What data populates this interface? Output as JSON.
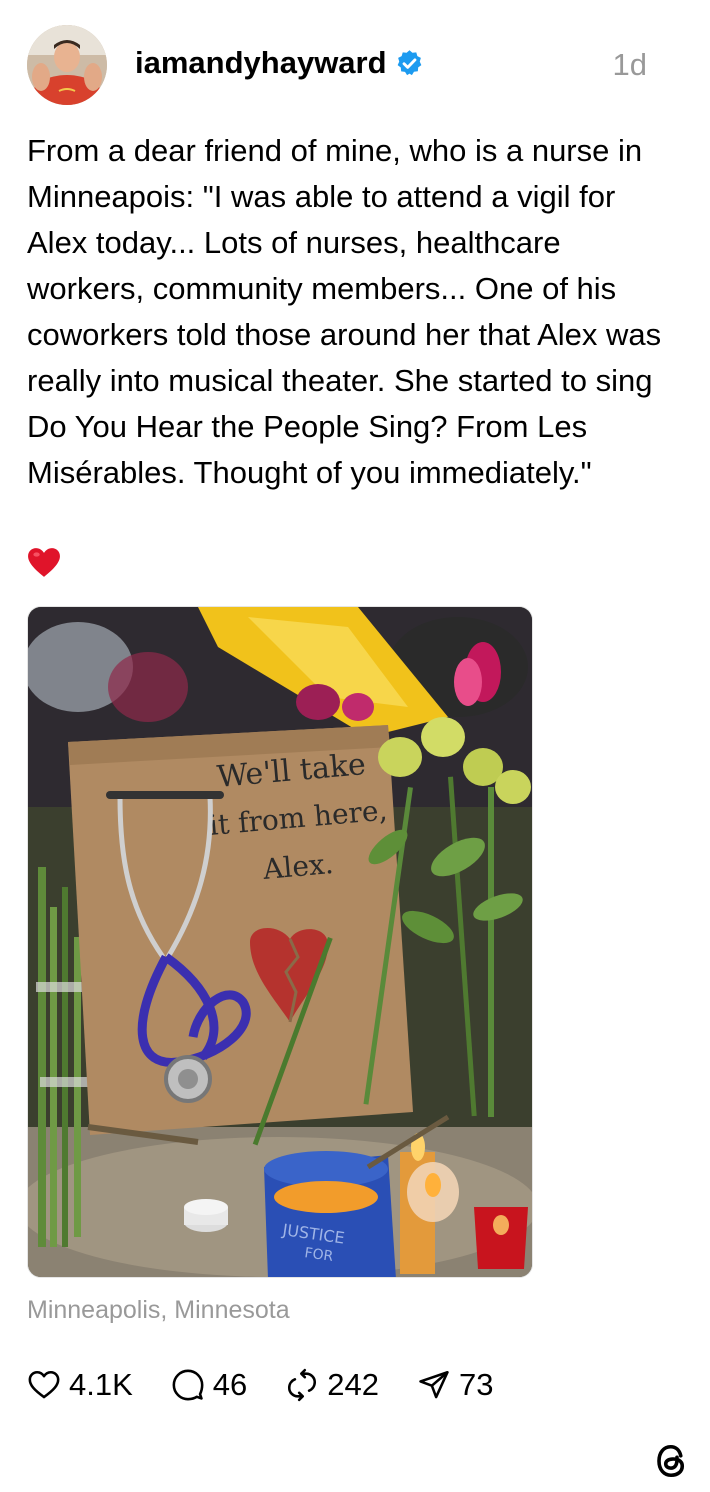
{
  "post": {
    "username": "iamandyhayward",
    "verified": true,
    "time": "1d",
    "text": "From a dear friend of mine, who is a nurse in Minneapois: \"I was able to attend a vigil for Alex today... Lots of nurses, healthcare workers, community members... One of his coworkers told those around her that Alex was really into musical theater. She started to sing Do You Hear the People Sing? From Les Misérables. Thought of you immediately.\"",
    "emoji": "heart-emoji",
    "photo": {
      "sign_text": [
        "We'll take",
        "it from here,",
        "Alex."
      ],
      "candle_text": [
        "JUSTICE",
        "FOR"
      ]
    },
    "location": "Minneapolis, Minnesota",
    "actions": {
      "likes": "4.1K",
      "replies": "46",
      "reposts": "242",
      "shares": "73"
    }
  },
  "colors": {
    "verified": "#1d9bf0",
    "muted": "#999999",
    "heart_emoji": "#e0142a"
  },
  "icons": [
    "heart-icon",
    "comment-icon",
    "repost-icon",
    "share-icon",
    "threads-logo-icon",
    "verified-icon"
  ]
}
